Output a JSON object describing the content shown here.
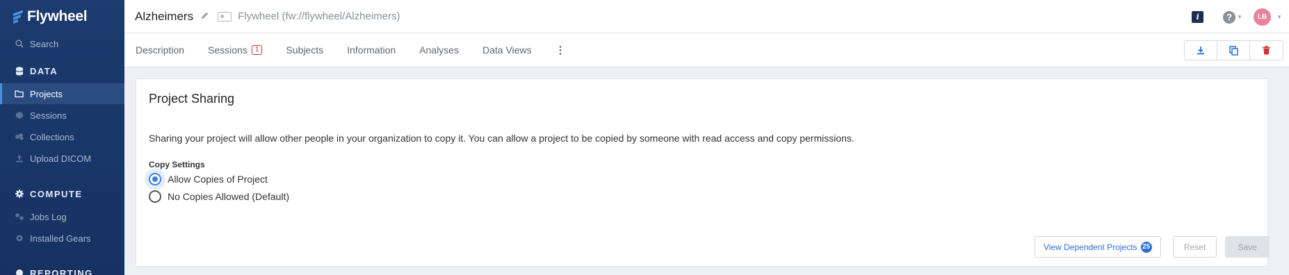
{
  "app": {
    "logo_text": "Flywheel"
  },
  "sidebar": {
    "search": "Search",
    "sections": [
      {
        "label": "DATA",
        "icon": "database-icon"
      },
      {
        "label": "COMPUTE",
        "icon": "gear-icon"
      },
      {
        "label": "REPORTING",
        "icon": "chart-icon"
      }
    ],
    "data_items": [
      {
        "label": "Projects",
        "icon": "folder-icon",
        "active": true
      },
      {
        "label": "Sessions",
        "icon": "cube-icon"
      },
      {
        "label": "Collections",
        "icon": "collections-icon"
      },
      {
        "label": "Upload DICOM",
        "icon": "upload-icon"
      }
    ],
    "compute_items": [
      {
        "label": "Jobs Log",
        "icon": "jobs-icon"
      },
      {
        "label": "Installed Gears",
        "icon": "gear-icon"
      }
    ]
  },
  "header": {
    "title": "Alzheimers",
    "path": "Flywheel (fw://flywheel/Alzheimers)",
    "avatar_initials": "LB"
  },
  "tabs": [
    {
      "label": "Description"
    },
    {
      "label": "Sessions",
      "badge": "1"
    },
    {
      "label": "Subjects"
    },
    {
      "label": "Information"
    },
    {
      "label": "Analyses"
    },
    {
      "label": "Data Views"
    }
  ],
  "sharing": {
    "title": "Project Sharing",
    "description": "Sharing your project will allow other people in your organization to copy it. You can allow a project to be copied by someone with read access and copy permissions.",
    "copy_settings_label": "Copy Settings",
    "options": [
      {
        "label": "Allow Copies of Project",
        "selected": true
      },
      {
        "label": "No Copies Allowed (Default)",
        "selected": false
      }
    ],
    "view_dependent_label": "View Dependent Projects",
    "dependent_count": "25",
    "reset_label": "Reset",
    "save_label": "Save"
  },
  "colors": {
    "accent": "#3b7ddd",
    "sidebar": "#1c3b6e",
    "danger": "#d0342c"
  }
}
